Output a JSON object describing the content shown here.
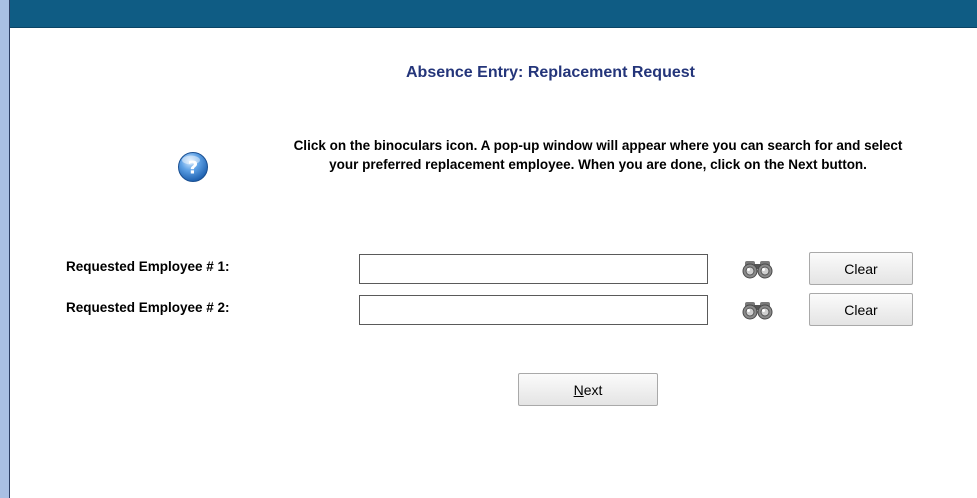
{
  "header": {
    "title": "Absence Entry: Replacement Request"
  },
  "instructions": {
    "text": "Click on the binoculars icon. A pop-up window will appear where you can search for and select your preferred replacement employee. When you are done, click on the Next button.",
    "help_icon": "help-question-icon"
  },
  "fields": [
    {
      "label": "Requested Employee # 1:",
      "value": "",
      "search_icon": "binoculars-icon",
      "clear_label": "Clear"
    },
    {
      "label": "Requested Employee # 2:",
      "value": "",
      "search_icon": "binoculars-icon",
      "clear_label": "Clear"
    }
  ],
  "actions": {
    "next_accesskey": "N",
    "next_rest": "ext"
  },
  "colors": {
    "topbar": "#0f5c84",
    "title": "#24357a",
    "outer_background": "#a9bfe3"
  }
}
